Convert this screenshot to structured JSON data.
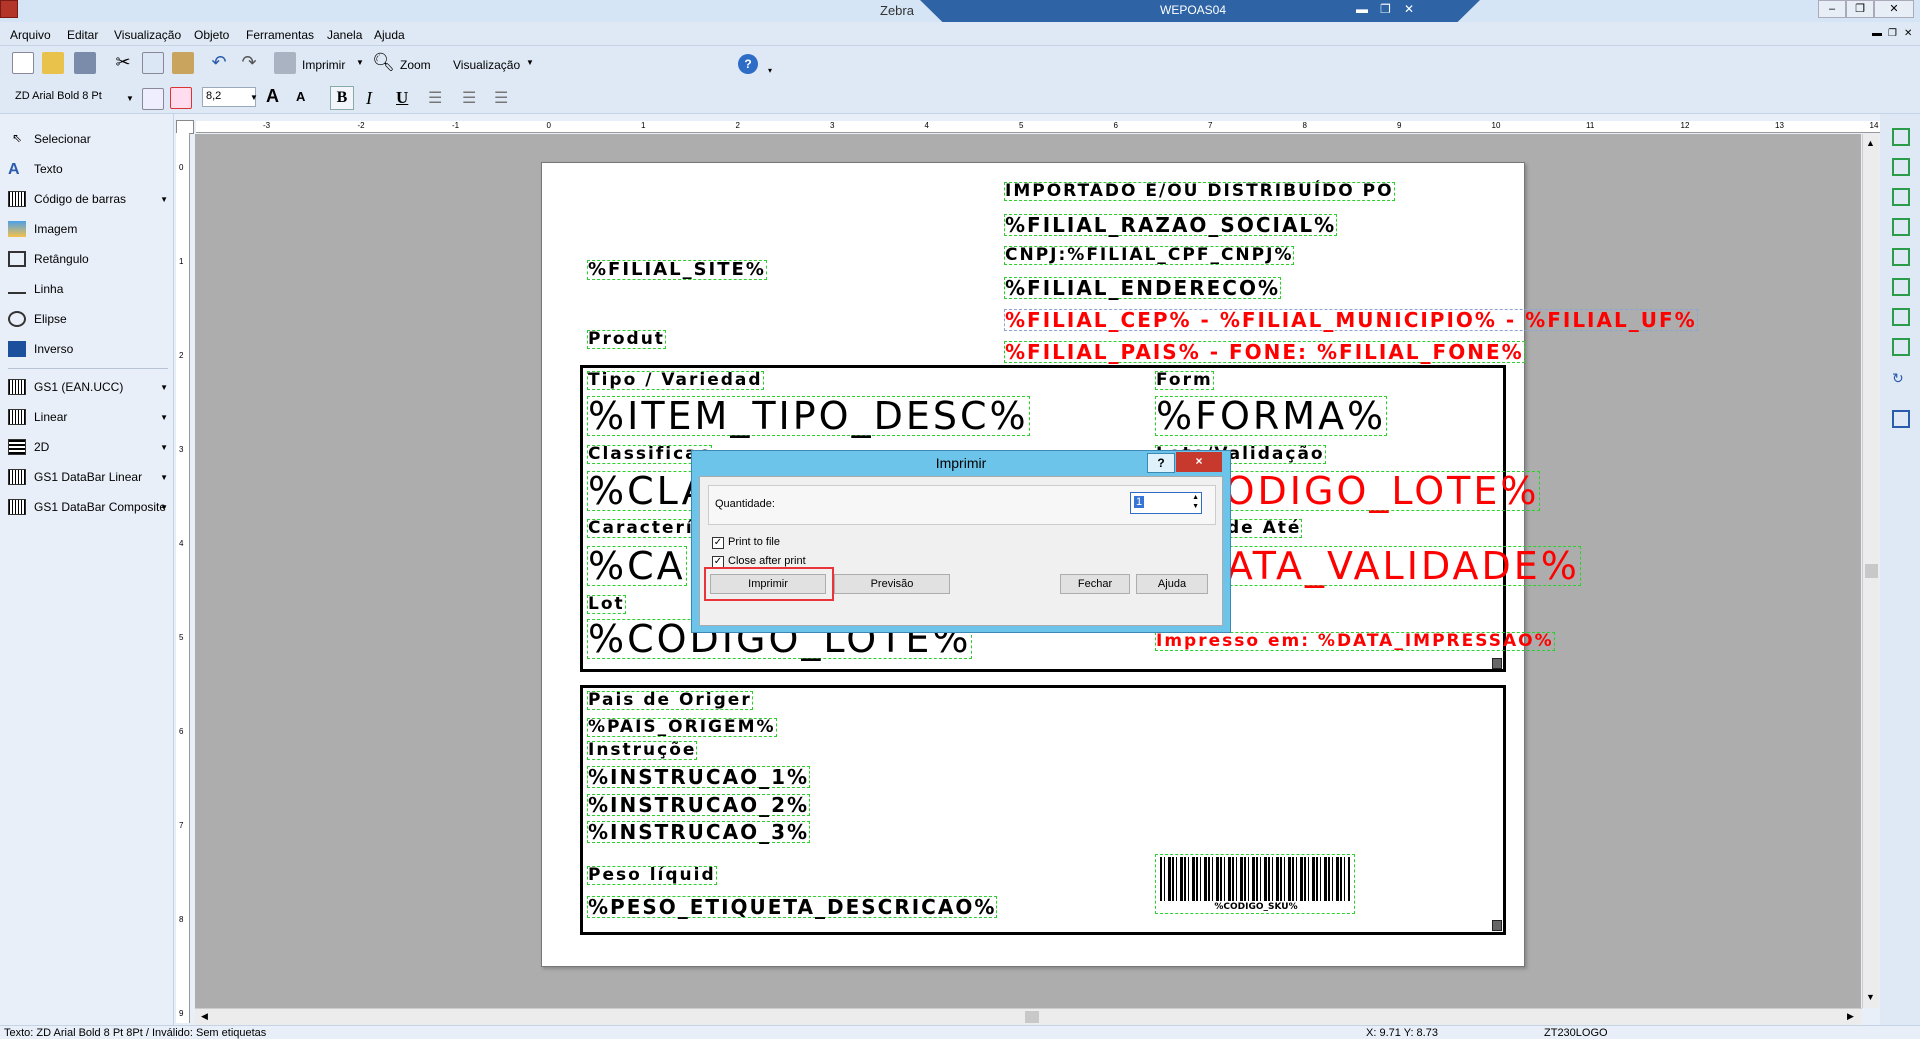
{
  "window": {
    "title": "Zebra",
    "remote_host": "WEPOAS04"
  },
  "menu": [
    "Arquivo",
    "Editar",
    "Visualização",
    "Objeto",
    "Ferramentas",
    "Janela",
    "Ajuda"
  ],
  "toolbar": {
    "print": "Imprimir",
    "zoom": "Zoom",
    "view": "Visualização",
    "font": "ZD Arial Bold 8 Pt",
    "size": "8,2",
    "bold": "B",
    "italic": "I",
    "underline": "U",
    "font_up": "A",
    "font_down": "A"
  },
  "tools": [
    "Selecionar",
    "Texto",
    "Código de barras",
    "Imagem",
    "Retângulo",
    "Linha",
    "Elipse",
    "Inverso",
    "GS1 (EAN.UCC)",
    "Linear",
    "2D",
    "GS1 DataBar Linear",
    "GS1 DataBar Composite"
  ],
  "ruler_h": [
    "-3",
    "-2",
    "-1",
    "0",
    "1",
    "2",
    "3",
    "4",
    "5",
    "6",
    "7",
    "8",
    "9",
    "10",
    "11",
    "12",
    "13",
    "14"
  ],
  "ruler_v": [
    "0",
    "1",
    "2",
    "3",
    "4",
    "5",
    "6",
    "7",
    "8",
    "9"
  ],
  "label": {
    "importado": "IMPORTADO E/OU DISTRIBUÍDO PO",
    "razao": "%FILIAL_RAZAO_SOCIAL%",
    "cnpj": "CNPJ:%FILIAL_CPF_CNPJ%",
    "endereco": "%FILIAL_ENDERECO%",
    "cep": "%FILIAL_CEP% - %FILIAL_MUNICIPIO% - %FILIAL_UF%",
    "pais_fone": "%FILIAL_PAIS% - FONE: %FILIAL_FONE%",
    "site": "%FILIAL_SITE%",
    "produto": "Produt",
    "tipo": "Tipo / Variedad",
    "item_tipo": "%ITEM_TIPO_DESC%",
    "forma_lbl": "Form",
    "forma": "%FORMA%",
    "classif": "Classificaç",
    "cla": "%CLA",
    "lote_lbl_r": "Lote/Validação",
    "codigo_lote_r": "%CODIGO_LOTE%",
    "caract": "Característ",
    "ca": "%CA",
    "validade_lbl": "Validade Até",
    "validade": "%DATA_VALIDADE%",
    "lot": "Lot",
    "codigo_lote": "%CODIGO_LOTE%",
    "impresso": "Impresso em: %DATA_IMPRESSAO%",
    "pais_lbl": "Pais de Origer",
    "pais": "%PAIS_ORIGEM%",
    "instrucao_lbl": "Instruçõe",
    "instr1": "%INSTRUCAO_1%",
    "instr2": "%INSTRUCAO_2%",
    "instr3": "%INSTRUCAO_3%",
    "peso_lbl": "Peso líquid",
    "peso": "%PESO_ETIQUETA_DESCRICAO%",
    "sku": "%CODIGO_SKU%"
  },
  "dialog": {
    "title": "Imprimir",
    "help": "?",
    "close": "×",
    "qty_label": "Quantidade:",
    "qty_value": "1",
    "print_to_file": "Print to file",
    "close_after": "Close after print",
    "btn_print": "Imprimir",
    "btn_preview": "Previsão",
    "btn_close": "Fechar",
    "btn_help": "Ajuda",
    "checked": "✓"
  },
  "status": {
    "left": "Texto: ZD Arial Bold 8 Pt 8Pt  / Inválido: Sem etiquetas",
    "coords": "X:  9.71 Y:  8.73",
    "printer": "ZT230LOGO"
  },
  "colors": {
    "accent": "#6cc4ea",
    "highlight": "#e8353a",
    "field_border": "#2bd12b",
    "red_text": "#ff0000"
  }
}
